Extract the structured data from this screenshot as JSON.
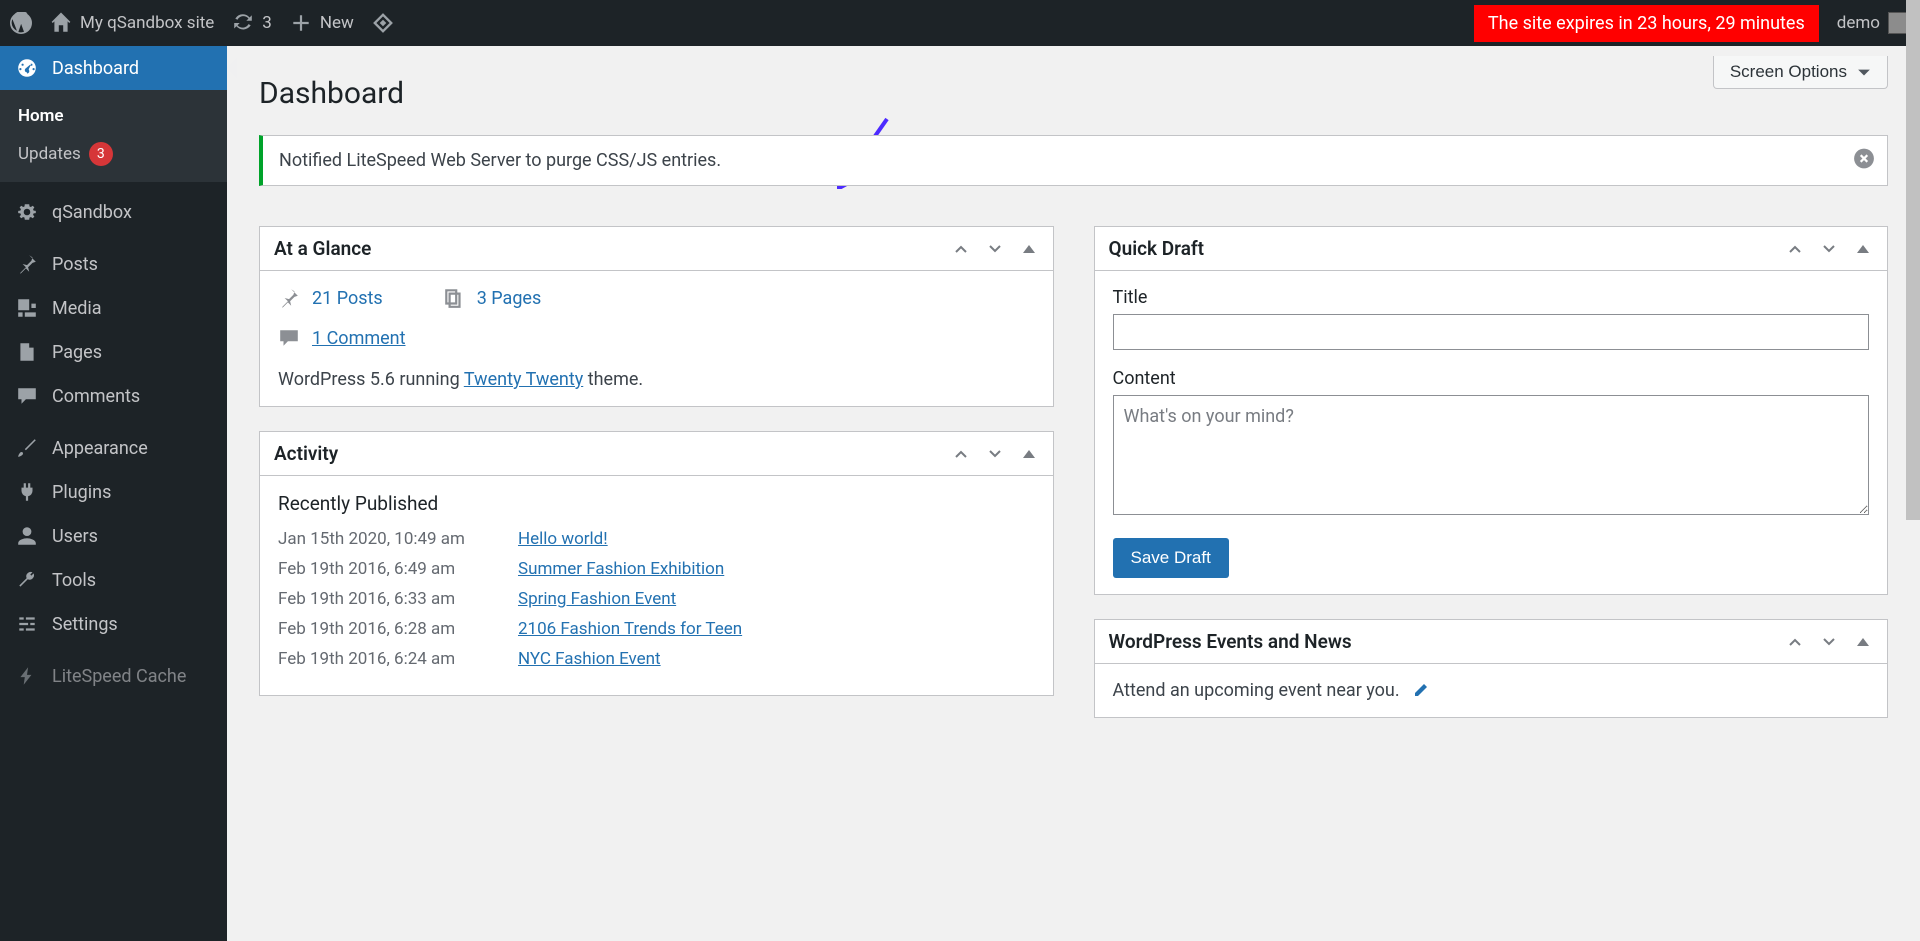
{
  "adminBar": {
    "siteName": "My qSandbox site",
    "refreshCount": "3",
    "newLabel": "New",
    "expireText": "The site expires in  23 hours, 29 minutes",
    "userName": "demo"
  },
  "sidebar": {
    "dashboard": "Dashboard",
    "home": "Home",
    "updates": "Updates",
    "updatesCount": "3",
    "qsandbox": "qSandbox",
    "posts": "Posts",
    "media": "Media",
    "pages": "Pages",
    "comments": "Comments",
    "appearance": "Appearance",
    "plugins": "Plugins",
    "users": "Users",
    "tools": "Tools",
    "settings": "Settings",
    "litespeed": "LiteSpeed Cache"
  },
  "screenOptions": "Screen Options",
  "pageTitle": "Dashboard",
  "notice": "Notified LiteSpeed Web Server to purge CSS/JS entries.",
  "glance": {
    "title": "At a Glance",
    "posts": "21 Posts",
    "pages": "3 Pages",
    "comments": "1 Comment",
    "versionPrefix": "WordPress 5.6 running ",
    "themeLink": "Twenty Twenty",
    "versionSuffix": " theme."
  },
  "activity": {
    "title": "Activity",
    "sectionTitle": "Recently Published",
    "rows": [
      {
        "date": "Jan 15th 2020, 10:49 am",
        "title": "Hello world!"
      },
      {
        "date": "Feb 19th 2016, 6:49 am",
        "title": "Summer Fashion Exhibition"
      },
      {
        "date": "Feb 19th 2016, 6:33 am",
        "title": "Spring Fashion Event"
      },
      {
        "date": "Feb 19th 2016, 6:28 am",
        "title": "2106 Fashion Trends for Teen"
      },
      {
        "date": "Feb 19th 2016, 6:24 am",
        "title": "NYC Fashion Event"
      }
    ]
  },
  "quickDraft": {
    "title": "Quick Draft",
    "titleLabel": "Title",
    "contentLabel": "Content",
    "contentPlaceholder": "What's on your mind?",
    "saveLabel": "Save Draft"
  },
  "events": {
    "title": "WordPress Events and News",
    "attendText": "Attend an upcoming event near you."
  }
}
